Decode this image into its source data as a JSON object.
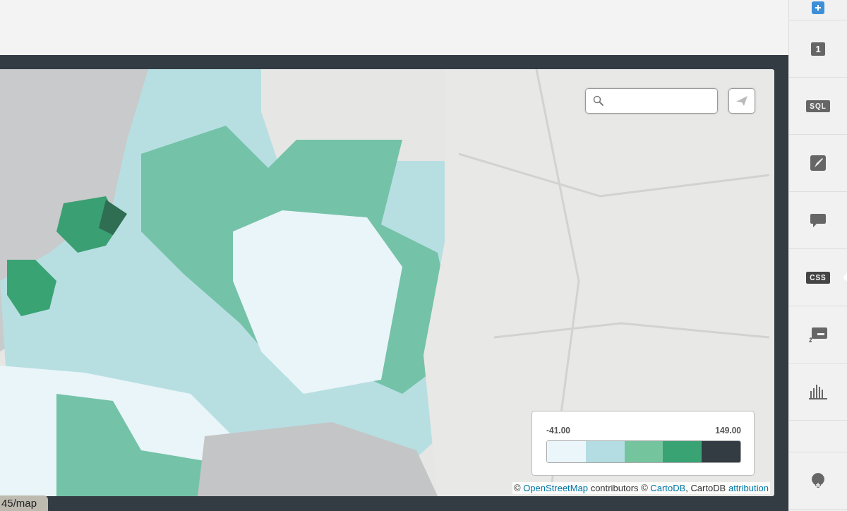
{
  "sidebar": {
    "items": [
      {
        "kind": "add",
        "selected": false
      },
      {
        "kind": "badge",
        "label": "1",
        "selected": false
      },
      {
        "kind": "tag",
        "label": "SQL",
        "selected": false
      },
      {
        "kind": "brush",
        "selected": false
      },
      {
        "kind": "comment",
        "selected": false
      },
      {
        "kind": "tag",
        "label": "CSS",
        "selected": true
      },
      {
        "kind": "legend",
        "selected": false
      },
      {
        "kind": "histogram",
        "selected": false
      },
      {
        "kind": "blank"
      },
      {
        "kind": "pin",
        "selected": false
      }
    ]
  },
  "map": {
    "kind": "picture",
    "legend": {
      "min": "-41.00",
      "max": "149.00",
      "swatches": [
        {
          "color": "#eaf6fa"
        },
        {
          "color": "#b3dde2"
        },
        {
          "color": "#74c49e"
        },
        {
          "color": "#3aa373"
        },
        {
          "color": "#333b43"
        }
      ]
    },
    "attribution": [
      {
        "text": "© ",
        "kind": "text"
      },
      {
        "text": "OpenStreetMap",
        "kind": "link"
      },
      {
        "text": " contributors © ",
        "kind": "text"
      },
      {
        "text": "CartoDB",
        "kind": "link"
      },
      {
        "text": ", CartoDB ",
        "kind": "text"
      },
      {
        "text": "attribution",
        "kind": "link"
      }
    ]
  },
  "status_bar": {
    "url": "45/map"
  }
}
